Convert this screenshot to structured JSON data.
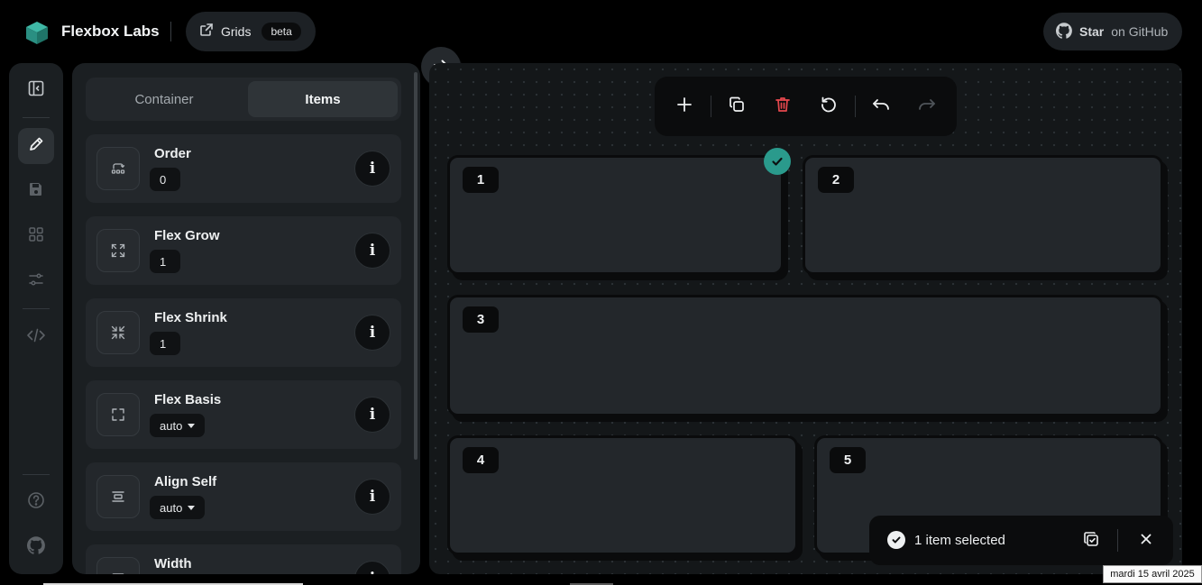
{
  "header": {
    "brand": "Flexbox Labs",
    "grids_label": "Grids",
    "beta_badge": "beta",
    "github_star": "Star",
    "github_on": "on GitHub"
  },
  "panel": {
    "tabs": [
      {
        "label": "Container",
        "active": false
      },
      {
        "label": "Items",
        "active": true
      }
    ],
    "properties": [
      {
        "name": "Order",
        "value": "0",
        "icon": "order-icon"
      },
      {
        "name": "Flex Grow",
        "value": "1",
        "icon": "expand-icon"
      },
      {
        "name": "Flex Shrink",
        "value": "1",
        "icon": "shrink-icon"
      },
      {
        "name": "Flex Basis",
        "value": "auto",
        "icon": "basis-icon",
        "dropdown": true
      },
      {
        "name": "Align Self",
        "value": "auto",
        "icon": "align-self-icon",
        "dropdown": true
      },
      {
        "name": "Width",
        "value": "",
        "icon": "width-icon"
      }
    ],
    "info_glyph": "i"
  },
  "canvas": {
    "items": [
      {
        "label": "1",
        "selected": true
      },
      {
        "label": "2"
      },
      {
        "label": "3"
      },
      {
        "label": "4"
      },
      {
        "label": "5"
      }
    ]
  },
  "toast": {
    "text": "1 item selected"
  },
  "taskbar": {
    "date": "mardi 15 avril 2025"
  },
  "colors": {
    "accent": "#2a9a8c",
    "delete": "#e5484d",
    "panel_bg": "#1b1f22",
    "item_bg": "#23272b"
  }
}
